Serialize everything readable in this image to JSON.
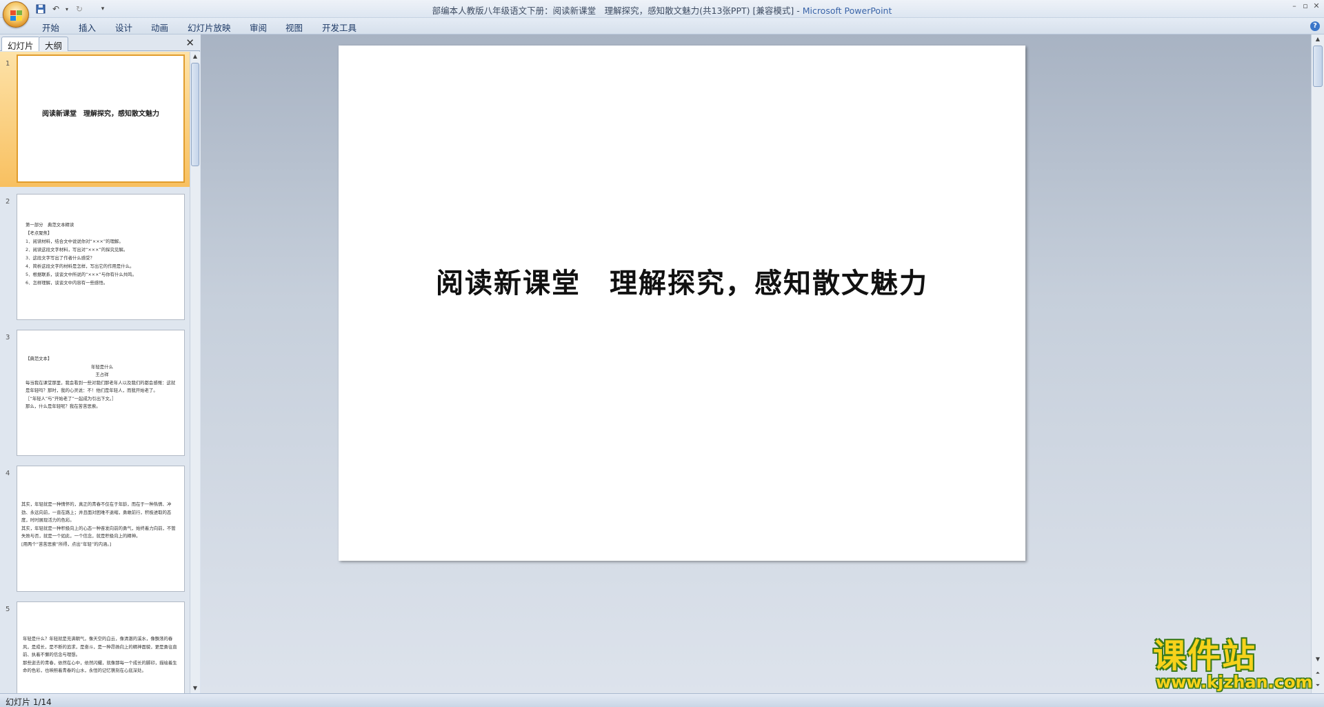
{
  "window": {
    "title_prefix": "部编本人教版八年级语文下册：阅读新课堂　理解探究，感知散文魅力(共13张PPT) [兼容模式] - ",
    "app_name": "Microsoft PowerPoint"
  },
  "ribbon": {
    "tabs": [
      "开始",
      "插入",
      "设计",
      "动画",
      "幻灯片放映",
      "审阅",
      "视图",
      "开发工具"
    ]
  },
  "left_pane": {
    "tabs": [
      "幻灯片",
      "大纲"
    ],
    "thumbnails": [
      {
        "number": "1",
        "title": "阅读新课堂　理解探究，感知散文魅力"
      },
      {
        "number": "2",
        "lines": [
          "第一部分　典范文本精读",
          "【考点聚焦】",
          "1．阅读材料，结合文中说说你对“×××”的理解。",
          "2．阅读这段文字材料，写出对“×××”的探究见解。",
          "3．这段文字写出了作者什么感受？",
          "4．简析这段文字的材料是怎样，写出它的作用是什么。",
          "5．根据联系，谈谈文中所说的“×××”与你有什么共鸣。",
          "6．怎样理解，谈谈文中内容有一些感悟。"
        ]
      },
      {
        "number": "3",
        "head": "【典范文本】",
        "center1": "年轻是什么",
        "center2": "王占祥",
        "lines": [
          "每当我在课堂那里，我会看到一些对我们那老年人以及我们的都会感慨：这就是年轻吗？那时，我的心灵说：不！他们是年轻人，而我开始老了。",
          "［“年轻人”与“开始老了”一起成为引出下文。］",
          "那么，什么是年轻呢？我在苦苦思索。"
        ]
      },
      {
        "number": "4",
        "lines": [
          "其实，年轻就是一种情怀的，真正的青春不仅在于年龄，而在于一种热情、冲劲、永远向前，一直在路上；并且面对困难不退缩，勇敢前行，积极进取的态度，时时展现活力的色彩。",
          "其实，年轻就是一种积极向上的心态一种奋发向前的勇气，始终着力向前，不管失败与否，就是一个如此，一个信念，就是积极向上的精神。",
          "[用两个“苦苦思索”所得，点出“年轻”的内涵。]"
        ]
      },
      {
        "number": "5",
        "lines": [
          "年轻是什么？年轻就是充满朝气，像天空的白云，像清澈的溪水，像飘荡的春风，是成长，是不断的追求，是奋斗，是一种昂扬向上的精神面貌，更是勇往直前、执着不懈的信念与理想。",
          "那些逝去的青春，依然在心中，依然闪耀，就像那每一个成长的脚印，描绘着生命的色彩，也映照着青春的山水，永恒的记忆镌刻在心底深处。"
        ]
      }
    ]
  },
  "slide": {
    "title": "阅读新课堂　理解探究，感知散文魅力"
  },
  "status_bar": {
    "text": "幻灯片 1/14"
  },
  "watermark": {
    "cn": "课件站",
    "url": "www.kjzhan.com"
  },
  "colors": {
    "ribbon_tab_text": "#1e3a66",
    "selected_thumb": "#f8c060",
    "watermark_fill": "#f7d21b",
    "watermark_outline": "#3b7a1a"
  }
}
